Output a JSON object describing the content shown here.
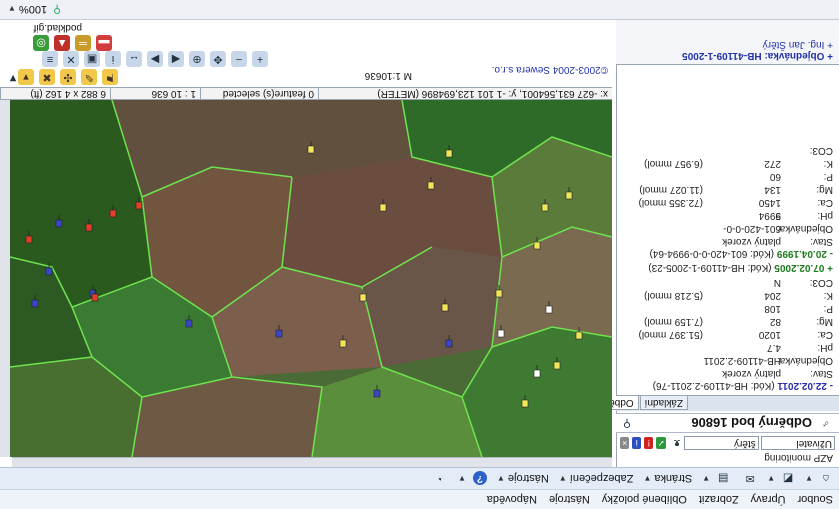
{
  "menubar": {
    "items": [
      "Soubor",
      "Úpravy",
      "Zobrazit",
      "Oblíbené položky",
      "Nástroje",
      "Nápověda"
    ]
  },
  "commandbar": {
    "items": [
      {
        "icon": "home-icon"
      },
      {
        "icon": "feeds-icon"
      },
      {
        "icon": "mail-icon"
      },
      {
        "icon": "print-icon"
      },
      {
        "label": "Stránka",
        "icon": "page-icon"
      },
      {
        "label": "Zabezpečení",
        "icon": "security-icon"
      },
      {
        "label": "Nástroje",
        "icon": "tools-icon"
      },
      {
        "icon": "help-icon"
      },
      {
        "icon": "research-icon"
      }
    ]
  },
  "statusbar": {
    "zoom": "100%"
  },
  "side_panel": {
    "header": "AZP monitoring",
    "search_value": "Uživatel",
    "search_value2": "štěrý",
    "title": "Odběrný bod 16806",
    "tabs": [
      "Základní",
      "Odběry"
    ],
    "records": [
      {
        "head": "- 22.02.2011",
        "head_color": "blue",
        "code": "(Kód: HB-41109-2.2011-76)",
        "lines": [
          {
            "k": "Stav:",
            "v": "platný vzorek",
            "u": ""
          },
          {
            "k": "Objednávka:",
            "v": "HB-41109-2.2011",
            "u": ""
          },
          {
            "k": "pH:",
            "v": "4.7",
            "u": ""
          },
          {
            "k": "Ca:",
            "v": "1020",
            "u": "(51.397 mmol)"
          },
          {
            "k": "Mg:",
            "v": "82",
            "u": "(7.159 mmol)"
          },
          {
            "k": "P:",
            "v": "108",
            "u": ""
          },
          {
            "k": "K:",
            "v": "204",
            "u": "(5.218 mmol)"
          },
          {
            "k": "CO3:",
            "v": "N",
            "u": ""
          }
        ]
      },
      {
        "head": "+ 07.02.2005",
        "head_color": "green",
        "code": "(Kód: HB-41109-1-2005-23)",
        "lines": []
      },
      {
        "head": "- 20.04.1999",
        "head_color": "green",
        "code": "(Kód: 601-420-0-0-9994-64)",
        "lines": [
          {
            "k": "Stav:",
            "v": "platný vzorek",
            "u": ""
          },
          {
            "k": "Objednávka:",
            "v": "601-420-0-0-9994",
            "u": ""
          },
          {
            "k": "pH:",
            "v": "5",
            "u": ""
          },
          {
            "k": "Ca:",
            "v": "1450",
            "u": "(72.355 mmol)"
          },
          {
            "k": "Mg:",
            "v": "134",
            "u": "(11.027 mmol)"
          },
          {
            "k": "P:",
            "v": "60",
            "u": ""
          },
          {
            "k": "K:",
            "v": "272",
            "u": "(6.957 mmol)"
          },
          {
            "k": "CO3:",
            "v": "",
            "u": ""
          }
        ]
      }
    ],
    "footer_line1": "+ Objednávka: HB-41109-1-2005",
    "footer_line2": "+ Ing. Jan Štěrý"
  },
  "map": {
    "coordbar": {
      "x": "x: -627 631,564001, y: -1 101 123,694896 (METER)",
      "features": "0 feature(s) selected",
      "scale": "1 : 10 636",
      "size": "6 882 x 4 162 (ft)"
    },
    "scale_label": "M 1:10636",
    "copyright": "©2003-2004 Sewera s.r.o.",
    "file_label": "podklad.gif",
    "tool_rows": [
      [
        "zoom-in-icon",
        "zoom-out-icon",
        "pan-icon",
        "zoom-window-icon",
        "zoom-prev-icon",
        "zoom-next-icon",
        "measure-icon",
        "identify-icon",
        "select-icon",
        "clear-icon",
        "layers-icon",
        "print-map-icon"
      ],
      [
        "overview-icon",
        "ruler-icon",
        "area-icon",
        "legend-icon"
      ],
      [
        "point-icon",
        "edit-icon",
        "move-icon",
        "delete-icon",
        "save-icon"
      ]
    ],
    "markers": [
      {
        "type": "yellow"
      },
      {
        "type": "yellow"
      },
      {
        "type": "yellow"
      },
      {
        "type": "yellow"
      },
      {
        "type": "yellow"
      },
      {
        "type": "yellow"
      },
      {
        "type": "yellow"
      },
      {
        "type": "yellow"
      },
      {
        "type": "yellow"
      },
      {
        "type": "yellow"
      },
      {
        "type": "yellow"
      },
      {
        "type": "yellow"
      },
      {
        "type": "yellow"
      },
      {
        "type": "yellow"
      },
      {
        "type": "blue"
      },
      {
        "type": "blue"
      },
      {
        "type": "blue"
      },
      {
        "type": "blue"
      },
      {
        "type": "blue"
      },
      {
        "type": "blue"
      },
      {
        "type": "blue"
      },
      {
        "type": "blue"
      },
      {
        "type": "red"
      },
      {
        "type": "red"
      },
      {
        "type": "red"
      },
      {
        "type": "red"
      },
      {
        "type": "red"
      },
      {
        "type": "white"
      },
      {
        "type": "white"
      },
      {
        "type": "white"
      }
    ]
  },
  "colors": {
    "field_green": "#2e8b2e",
    "forest": "#1f4a1a",
    "plowed": "#6b4a3a",
    "boundary": "#66e04a"
  }
}
